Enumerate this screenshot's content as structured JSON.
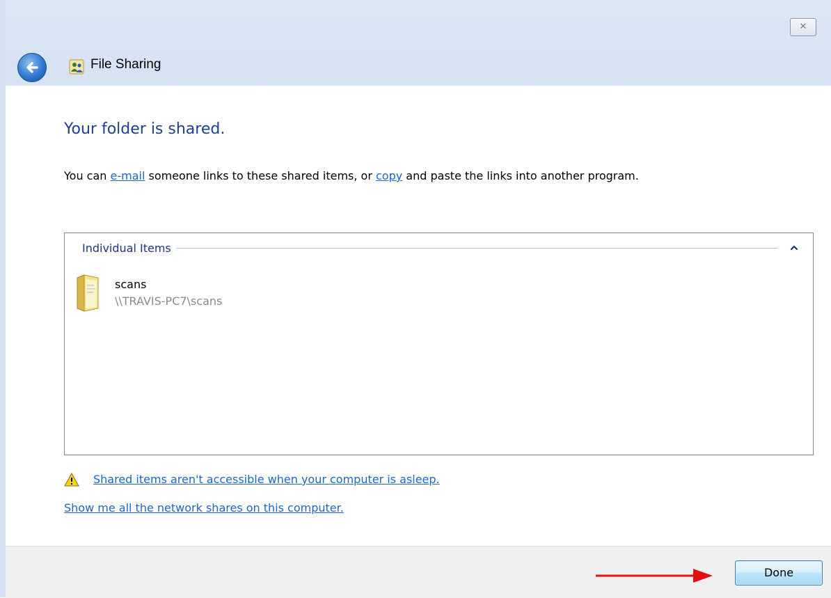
{
  "window": {
    "title": "File Sharing",
    "close_glyph": "✕"
  },
  "content": {
    "heading": "Your folder is shared.",
    "desc_prefix": "You can ",
    "email_link": "e-mail",
    "desc_middle": " someone links to these shared items, or ",
    "copy_link": "copy",
    "desc_suffix": " and paste the links into another program."
  },
  "items_group": {
    "title": "Individual Items",
    "items": [
      {
        "name": "scans",
        "path": "\\\\TRAVIS-PC7\\scans"
      }
    ]
  },
  "links": {
    "asleep_warning": "Shared items aren't accessible when your computer is asleep.",
    "show_shares": "Show me all the network shares on this computer."
  },
  "footer": {
    "done_label": "Done"
  },
  "icons": {
    "back": "back-arrow-icon",
    "share": "share-users-icon",
    "folder": "folder-icon",
    "warning": "warning-icon",
    "collapse": "chevron-up-icon"
  },
  "colors": {
    "heading": "#1e3f8c",
    "link": "#1c65c9",
    "annotation_arrow": "#e01010"
  }
}
